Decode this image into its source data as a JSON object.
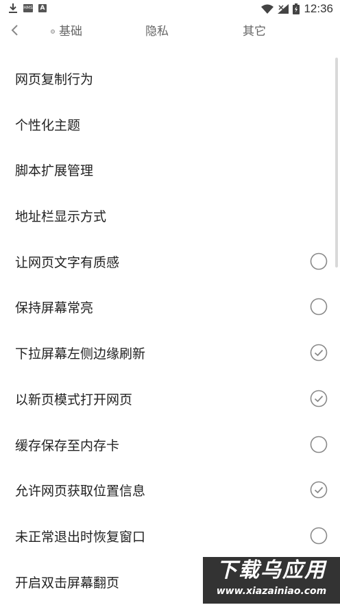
{
  "status_bar": {
    "time": "12:36",
    "icons": [
      "download-icon",
      "hms-icon",
      "a-icon",
      "wifi-icon",
      "signal-icon",
      "battery-icon"
    ],
    "hms_text": "HMS",
    "a_text": "A"
  },
  "tabs": [
    {
      "label": "基础"
    },
    {
      "label": "隐私"
    },
    {
      "label": "其它"
    }
  ],
  "settings": [
    {
      "label": "网页复制行为",
      "toggle": null
    },
    {
      "label": "个性化主题",
      "toggle": null
    },
    {
      "label": "脚本扩展管理",
      "toggle": null
    },
    {
      "label": "地址栏显示方式",
      "toggle": null
    },
    {
      "label": "让网页文字有质感",
      "toggle": false
    },
    {
      "label": "保持屏幕常亮",
      "toggle": false
    },
    {
      "label": "下拉屏幕左侧边缘刷新",
      "toggle": true
    },
    {
      "label": "以新页模式打开网页",
      "toggle": true
    },
    {
      "label": "缓存保存至内存卡",
      "toggle": false
    },
    {
      "label": "允许网页获取位置信息",
      "toggle": true
    },
    {
      "label": "未正常退出时恢复窗口",
      "toggle": false
    },
    {
      "label": "开启双击屏幕翻页",
      "toggle": null
    }
  ],
  "watermark": {
    "title": "下载乌应用",
    "url": "www.xiazainiao.com"
  },
  "colors": {
    "text": "#222222",
    "tab_text": "#666666",
    "check_stroke": "#888888"
  }
}
